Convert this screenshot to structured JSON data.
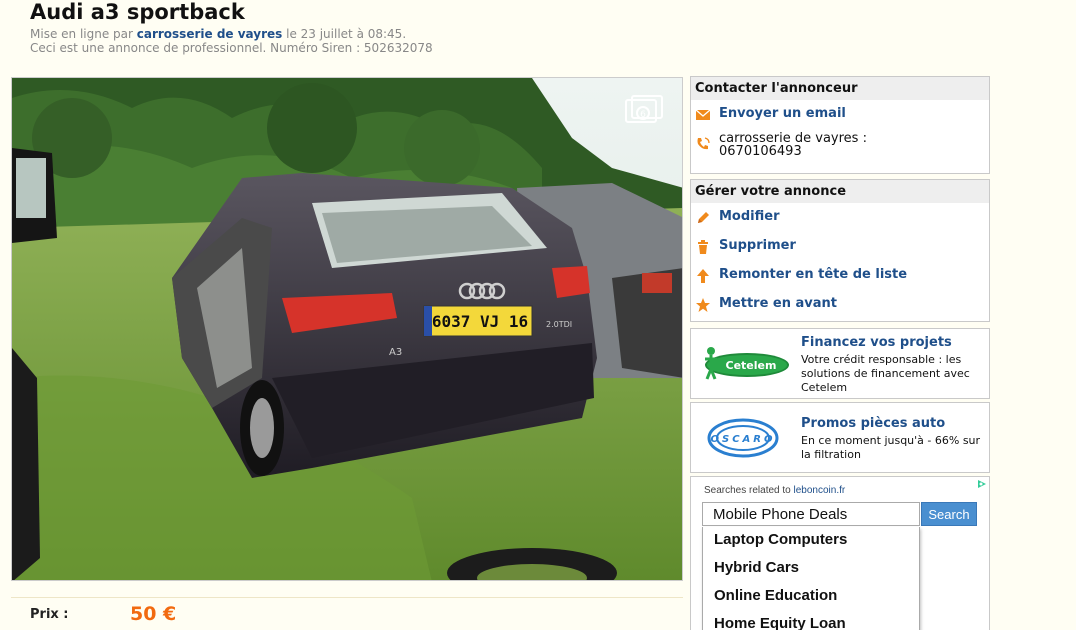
{
  "ad": {
    "title": "Audi a3 sportback",
    "posted_prefix": "Mise en ligne par ",
    "seller": "carrosserie de vayres",
    "posted_suffix": " le 23 juillet à 08:45.",
    "pro_notice": "Ceci est une annonce de professionnel. Numéro Siren : 502632078",
    "price_label": "Prix :",
    "price_value": "50 €",
    "photo": {
      "plate_text": "6037 VJ 16",
      "model_badge": "A3",
      "engine_badge": "2.0TDI"
    }
  },
  "contact": {
    "header": "Contacter l'annonceur",
    "email_label": "Envoyer un email",
    "phone_name": "carrosserie de vayres :",
    "phone_number": "0670106493"
  },
  "manage": {
    "header": "Gérer votre annonce",
    "items": [
      {
        "label": "Modifier",
        "icon": "pencil-icon"
      },
      {
        "label": "Supprimer",
        "icon": "trash-icon"
      },
      {
        "label": "Remonter en tête de liste",
        "icon": "arrow-up-icon"
      },
      {
        "label": "Mettre en avant",
        "icon": "star-icon"
      }
    ]
  },
  "promos": [
    {
      "logo": "Cetelem",
      "title": "Financez vos projets",
      "text": "Votre crédit responsable : les solutions de financement avec Cetelem"
    },
    {
      "logo": "OSCARO",
      "title": "Promos pièces auto",
      "text": "En ce moment jusqu'à - 66% sur la filtration"
    }
  ],
  "ads": {
    "caption_prefix": "Searches related to ",
    "caption_site": "leboncoin.fr",
    "search_value": "Mobile Phone Deals",
    "search_button": "Search",
    "suggestions": [
      "Laptop Computers",
      "Hybrid Cars",
      "Online Education",
      "Home Equity Loan"
    ]
  },
  "colors": {
    "link": "#1f4f8a",
    "price": "#f26a10",
    "icon_orange": "#f08a1c",
    "background": "#fffef3"
  }
}
